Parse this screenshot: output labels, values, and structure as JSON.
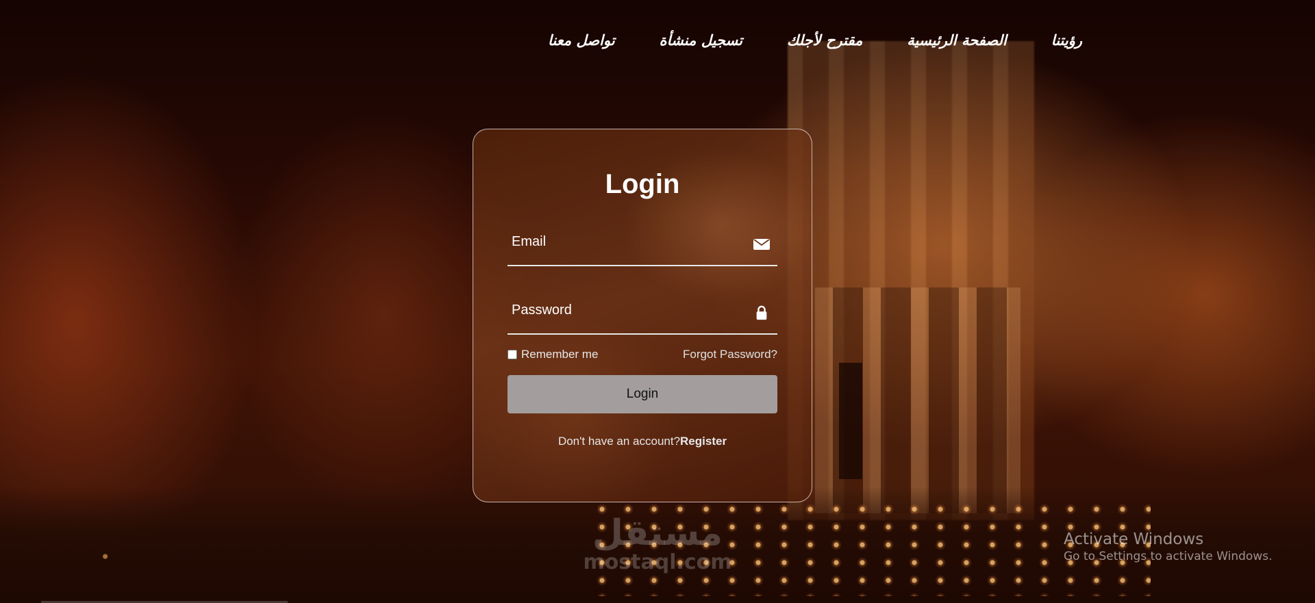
{
  "nav": {
    "items": [
      {
        "label": "رؤيتنا"
      },
      {
        "label": "الصفحة الرئيسية"
      },
      {
        "label": "مقترح لأجلك"
      },
      {
        "label": "تسجيل منشأة"
      },
      {
        "label": "تواصل معنا"
      }
    ]
  },
  "login": {
    "title": "Login",
    "email_label": "Email",
    "email_icon": "envelope-icon",
    "password_label": "Password",
    "password_icon": "lock-icon",
    "remember_label": "Remember me",
    "remember_checked": false,
    "forgot_label": "Forgot Password?",
    "button_label": "Login",
    "no_account_text": "Don't have an account?",
    "register_label": "Register"
  },
  "watermark": {
    "logo_text": "مستقل",
    "domain": "mostaql.com"
  },
  "system": {
    "activate_title": "Activate Windows",
    "activate_subtitle": "Go to Settings to activate Windows."
  },
  "colors": {
    "button_bg": "#a39e9d",
    "text": "#ffffff"
  }
}
